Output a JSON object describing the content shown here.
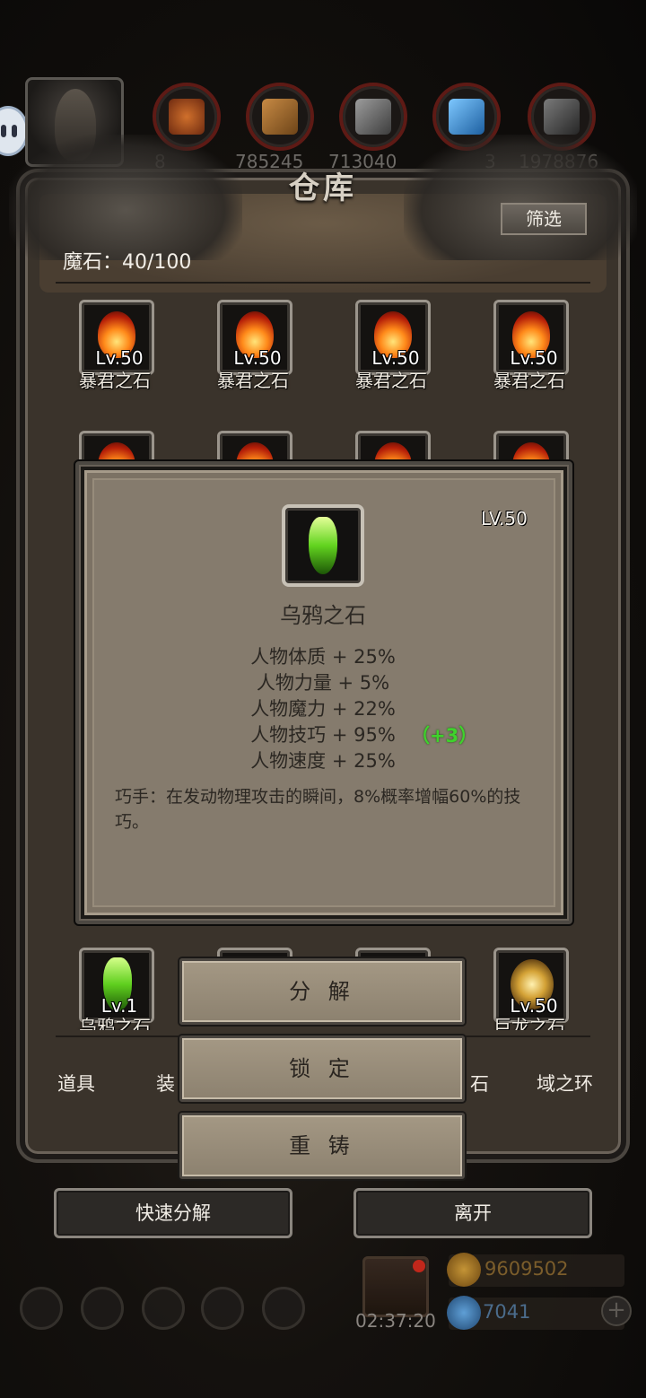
{
  "resources": {
    "values": [
      "8",
      "785245",
      "713040",
      "",
      "3",
      "1978876"
    ]
  },
  "warehouse": {
    "title": "仓库",
    "filter_label": "筛选",
    "count_label": "魔石：40/100",
    "grid_row1": [
      {
        "level": "Lv.50",
        "name": "暴君之石"
      },
      {
        "level": "Lv.50",
        "name": "暴君之石"
      },
      {
        "level": "Lv.50",
        "name": "暴君之石"
      },
      {
        "level": "Lv.50",
        "name": "暴君之石"
      }
    ],
    "grid_bottom": [
      {
        "level": "Lv.1",
        "name": "乌鸦之石"
      },
      {
        "level": "",
        "name": ""
      },
      {
        "level": "",
        "name": ""
      },
      {
        "level": "Lv.50",
        "name": "巨龙之石"
      }
    ],
    "tabs": [
      "道具",
      "装",
      "石",
      "域之环"
    ],
    "footer": {
      "quick_decompose": "快速分解",
      "leave": "离开"
    }
  },
  "tooltip": {
    "level": "LV.50",
    "name": "乌鸦之石",
    "stats": [
      "人物体质 + 25%",
      "人物力量 + 5%",
      "人物魔力 + 22%",
      "人物技巧 + 95%",
      "人物速度 + 25%"
    ],
    "bonus": "（+3）",
    "description": "巧手：在发动物理攻击的瞬间，8%概率增幅60%的技巧。"
  },
  "actions": {
    "decompose": "分 解",
    "lock": "锁 定",
    "recast": "重 铸"
  },
  "hud": {
    "timer": "02:37:20",
    "gold": "9609502",
    "gems": "7041",
    "plus": "+"
  }
}
